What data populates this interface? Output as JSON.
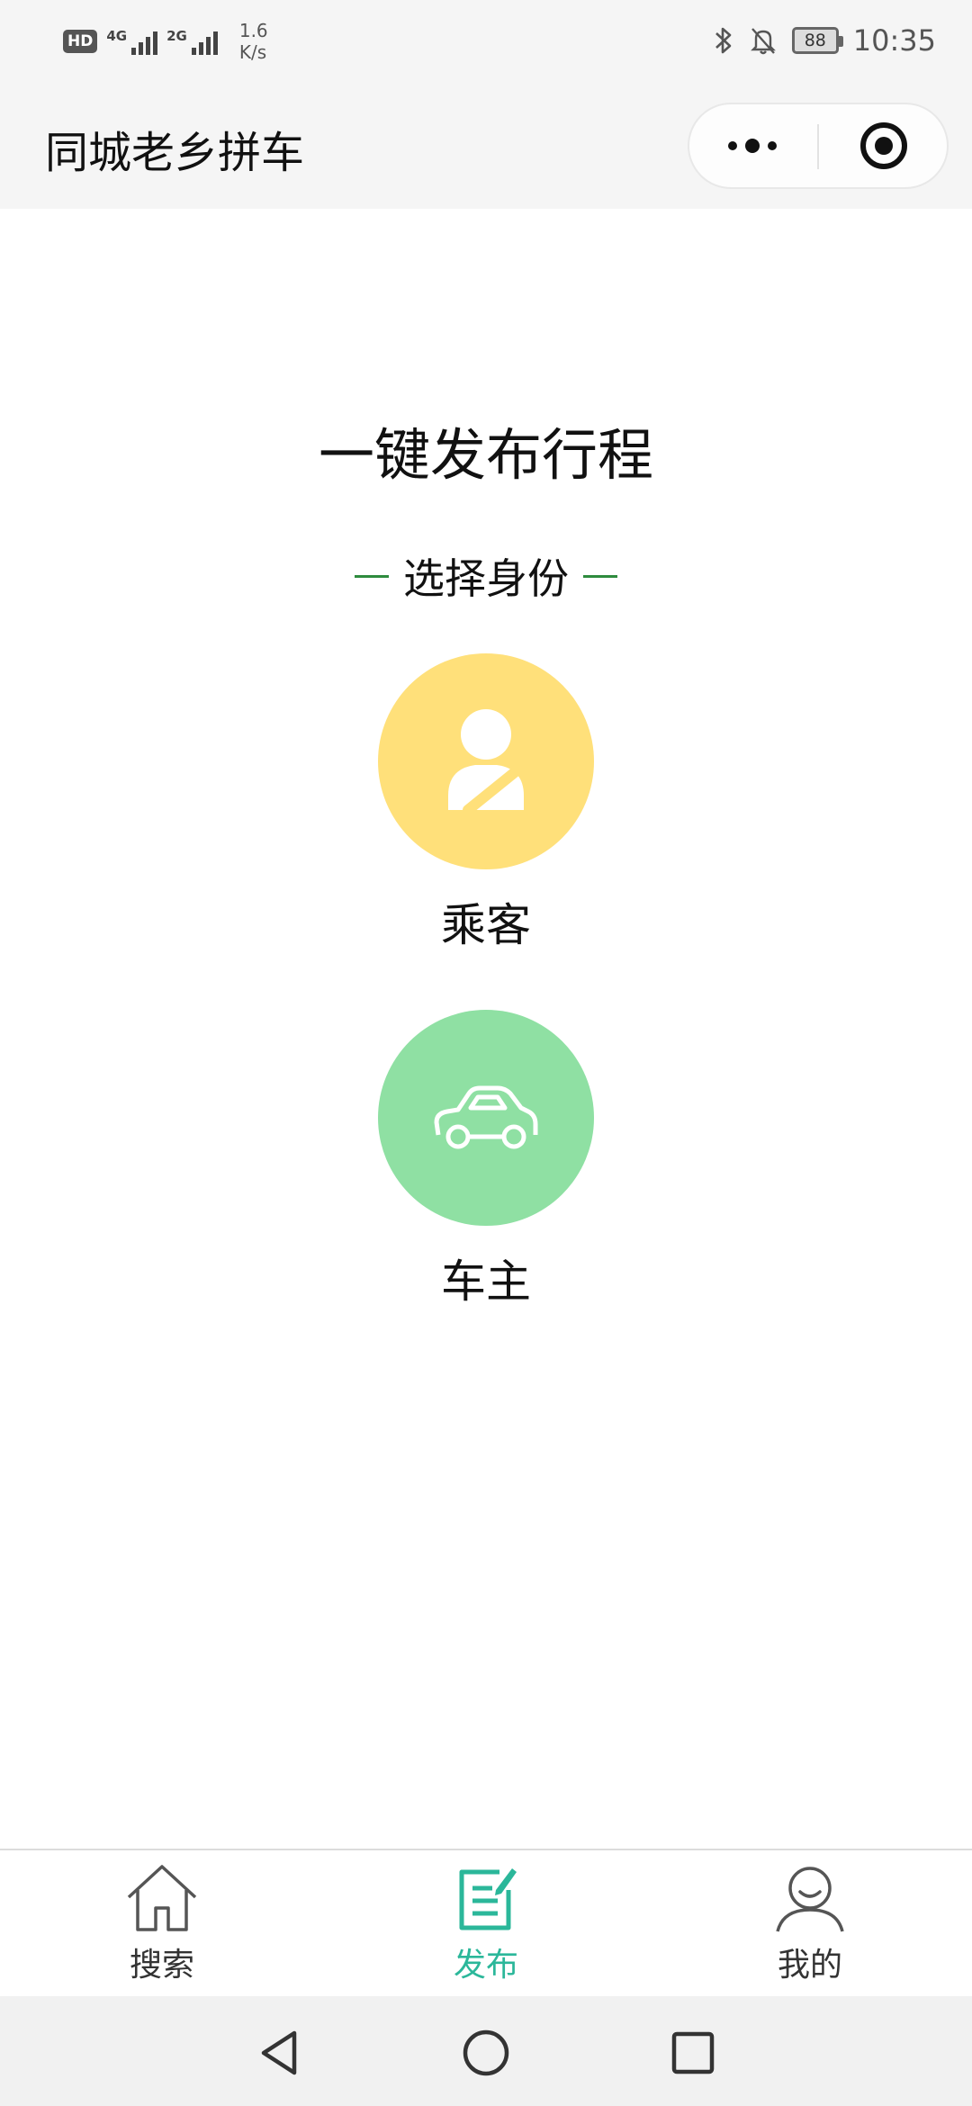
{
  "status_bar": {
    "hd": "HD",
    "net1": "4G",
    "net2": "2G",
    "speed_value": "1.6",
    "speed_unit": "K/s",
    "battery": "88",
    "time": "10:35"
  },
  "title_bar": {
    "title": "同城老乡拼车"
  },
  "main": {
    "heading": "一键发布行程",
    "section_label": "选择身份",
    "roles": [
      {
        "label": "乘客",
        "color": "#ffe07a",
        "icon": "passenger-icon"
      },
      {
        "label": "车主",
        "color": "#8fe0a3",
        "icon": "car-icon"
      }
    ]
  },
  "tab_bar": {
    "active_color": "#2bb79a",
    "tabs": [
      {
        "label": "搜索",
        "icon": "home-icon"
      },
      {
        "label": "发布",
        "icon": "edit-icon",
        "active": true
      },
      {
        "label": "我的",
        "icon": "user-icon"
      }
    ]
  },
  "nav_bar": {
    "buttons": [
      "back-icon",
      "home-circle-icon",
      "recent-apps-icon"
    ]
  }
}
